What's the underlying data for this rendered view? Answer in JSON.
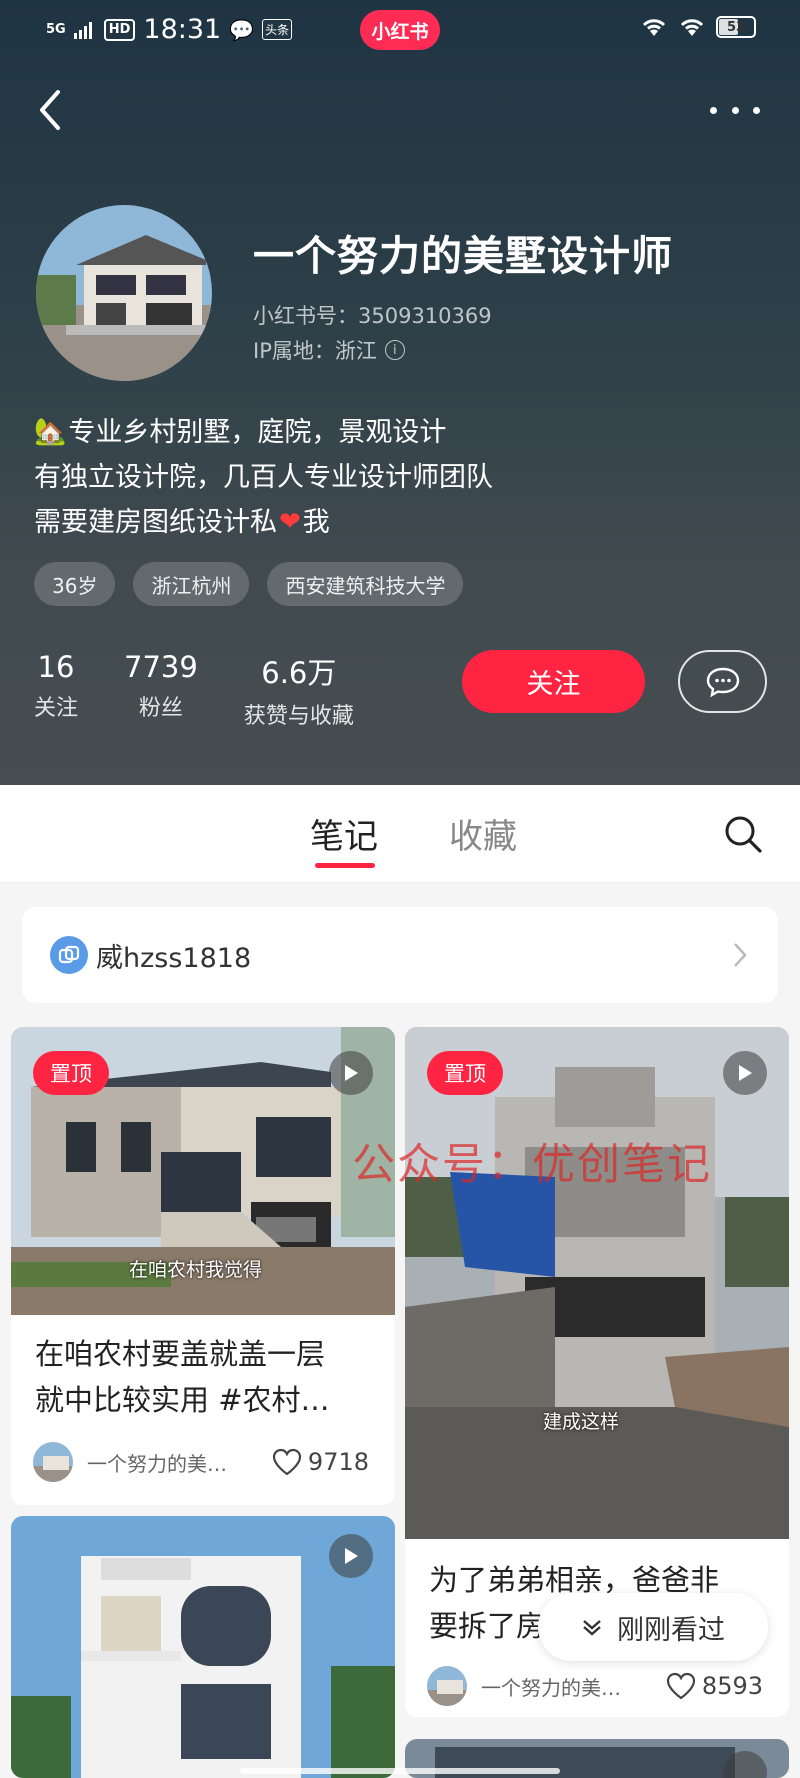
{
  "status_bar": {
    "signal": "5G",
    "hd": "HD",
    "time": "18:31",
    "toutiao": "头条",
    "app_badge": "小红书",
    "battery": "53",
    "battery_level": 0.53
  },
  "profile": {
    "nickname": "一个努力的美墅设计师",
    "red_id": "小红书号：3509310369",
    "ip_location": "IP属地：浙江",
    "bio_line1": "专业乡村别墅，庭院，景观设计",
    "bio_line2": "有独立设计院，几百人专业设计师团队",
    "bio_line3_a": "需要建房图纸设计私",
    "bio_line3_b": "我",
    "tags": [
      "36岁",
      "浙江杭州",
      "西安建筑科技大学"
    ],
    "stats": [
      {
        "num": "16",
        "label": "关注"
      },
      {
        "num": "7739",
        "label": "粉丝"
      },
      {
        "num": "6.6万",
        "label": "获赞与收藏"
      }
    ],
    "follow_label": "关注"
  },
  "tabs": {
    "notes": "笔记",
    "collections": "收藏"
  },
  "wechat_bar": {
    "text": "威hzss1818"
  },
  "notes": [
    {
      "pinned": "置顶",
      "caption": "在咱农村我觉得",
      "title_line1": "在咱农村要盖就盖一层",
      "title_line2": "就中比较实用 #农村…",
      "author": "一个努力的美…",
      "likes": "9718"
    },
    {
      "pinned": "置顶",
      "caption": "建成这样",
      "title_line1": "为了弟弟相亲，爸爸非",
      "title_line2": "要拆了房",
      "author": "一个努力的美…",
      "likes": "8593"
    }
  ],
  "watermark": "公众号：优创笔记",
  "recent_pill": "刚刚看过",
  "colors": {
    "accent": "#ff2442",
    "header_top": "#1f3443",
    "header_bottom": "#474d50"
  }
}
